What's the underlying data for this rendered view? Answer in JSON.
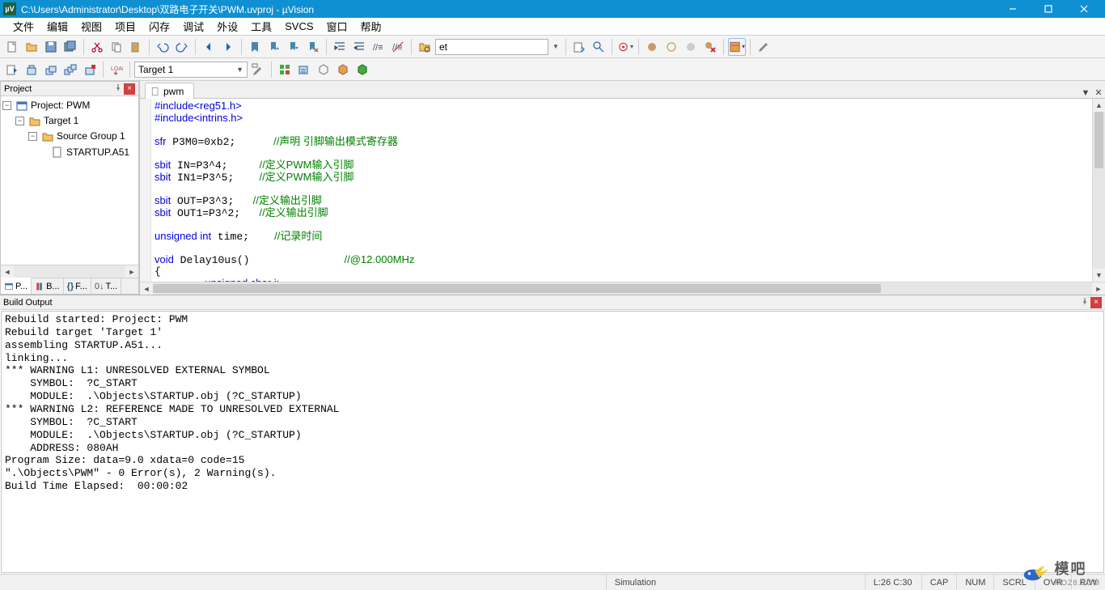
{
  "window": {
    "title": "C:\\Users\\Administrator\\Desktop\\双路电子开关\\PWM.uvproj - µVision"
  },
  "menu": [
    "文件",
    "编辑",
    "视图",
    "项目",
    "闪存",
    "调试",
    "外设",
    "工具",
    "SVCS",
    "窗口",
    "帮助"
  ],
  "toolbar1": {
    "find_text": "et"
  },
  "toolbar2": {
    "target_combo": "Target 1"
  },
  "project": {
    "header": "Project",
    "tree": {
      "root": "Project: PWM",
      "target": "Target 1",
      "group": "Source Group 1",
      "file": "STARTUP.A51"
    },
    "tabs": [
      "P...",
      "B...",
      "F...",
      "T..."
    ],
    "tab_prefixes": [
      "",
      "{}",
      "{}",
      "0↓"
    ],
    "tab_icons": [
      "project",
      "books",
      "functions",
      "templates"
    ]
  },
  "editor": {
    "tab": "pwm",
    "code_lines": [
      {
        "t": "#include<reg51.h>",
        "c": "kw"
      },
      {
        "t": "#include<intrins.h>",
        "c": "kw"
      },
      {
        "t": "",
        "c": ""
      },
      {
        "t": "sfr P3M0=0xb2;      //声明 引脚输出模式寄存器",
        "c": "mix",
        "kw": "sfr",
        "body": " P3M0=0xb2;      ",
        "cm": "//声明 引脚输出模式寄存器"
      },
      {
        "t": "",
        "c": ""
      },
      {
        "t": "sbit IN=P3^4;     //定义PWM输入引脚",
        "c": "mix",
        "kw": "sbit",
        "body": " IN=P3^4;     ",
        "cm": "//定义PWM输入引脚"
      },
      {
        "t": "sbit IN1=P3^5;    //定义PWM输入引脚",
        "c": "mix",
        "kw": "sbit",
        "body": " IN1=P3^5;    ",
        "cm": "//定义PWM输入引脚"
      },
      {
        "t": "",
        "c": ""
      },
      {
        "t": "sbit OUT=P3^3;   //定义输出引脚",
        "c": "mix",
        "kw": "sbit",
        "body": " OUT=P3^3;   ",
        "cm": "//定义输出引脚"
      },
      {
        "t": "sbit OUT1=P3^2;   //定义输出引脚",
        "c": "mix",
        "kw": "sbit",
        "body": " OUT1=P3^2;   ",
        "cm": "//定义输出引脚"
      },
      {
        "t": "",
        "c": ""
      },
      {
        "t": "unsigned int time;    //记录时间",
        "c": "mix",
        "kw": "unsigned int",
        "body": " time;    ",
        "cm": "//记录时间"
      },
      {
        "t": "",
        "c": ""
      },
      {
        "t": "void Delay10us()               //@12.000MHz",
        "c": "mix",
        "kw": "void",
        "body": " Delay10us()               ",
        "cm": "//@12.000MHz"
      },
      {
        "t": "{",
        "c": ""
      },
      {
        "t": "        unsigned char i;",
        "c": "mix",
        "kw": "",
        "body": "        ",
        "cm": "",
        "tail": "unsigned char i;",
        "tailc": "kw_part"
      }
    ]
  },
  "build": {
    "header": "Build Output",
    "lines": [
      "Rebuild started: Project: PWM",
      "Rebuild target 'Target 1'",
      "assembling STARTUP.A51...",
      "linking...",
      "*** WARNING L1: UNRESOLVED EXTERNAL SYMBOL",
      "    SYMBOL:  ?C_START",
      "    MODULE:  .\\Objects\\STARTUP.obj (?C_STARTUP)",
      "*** WARNING L2: REFERENCE MADE TO UNRESOLVED EXTERNAL",
      "    SYMBOL:  ?C_START",
      "    MODULE:  .\\Objects\\STARTUP.obj (?C_STARTUP)",
      "    ADDRESS: 080AH",
      "Program Size: data=9.0 xdata=0 code=15",
      "\".\\Objects\\PWM\" - 0 Error(s), 2 Warning(s).",
      "Build Time Elapsed:  00:00:02"
    ]
  },
  "status": {
    "mode": "Simulation",
    "pos": "L:26 C:30",
    "caps": "CAP",
    "num": "NUM",
    "scrl": "SCRL",
    "ovr": "OVR",
    "rw": "R/W"
  },
  "watermark": {
    "text": "模吧",
    "sub": "MOZ8.COM"
  }
}
